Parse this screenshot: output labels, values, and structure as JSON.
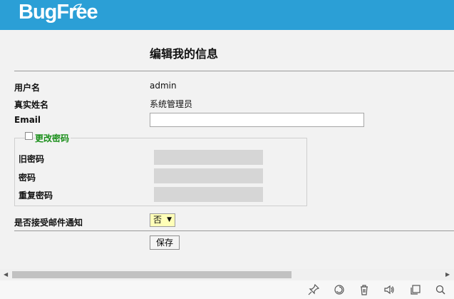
{
  "brand": {
    "logo": "BugFree"
  },
  "page": {
    "title": "编辑我的信息"
  },
  "form": {
    "username_label": "用户名",
    "username_value": "admin",
    "realname_label": "真实姓名",
    "realname_value": "系统管理员",
    "email_label": "Email",
    "email_value": "",
    "change_password_label": "更改密码",
    "change_password_checked": false,
    "old_password_label": "旧密码",
    "password_label": "密码",
    "repeat_password_label": "重复密码",
    "notify_label": "是否接受邮件通知",
    "notify_value": "否",
    "save_label": "保存"
  },
  "bottom_toolbar": {
    "icons": [
      "pin-icon",
      "refresh-icon",
      "trash-icon",
      "speaker-icon",
      "window-icon",
      "search-icon"
    ]
  },
  "colors": {
    "header": "#2b9fd6",
    "legend_text": "#1a8f1a",
    "select_bg": "#ffffb8"
  }
}
